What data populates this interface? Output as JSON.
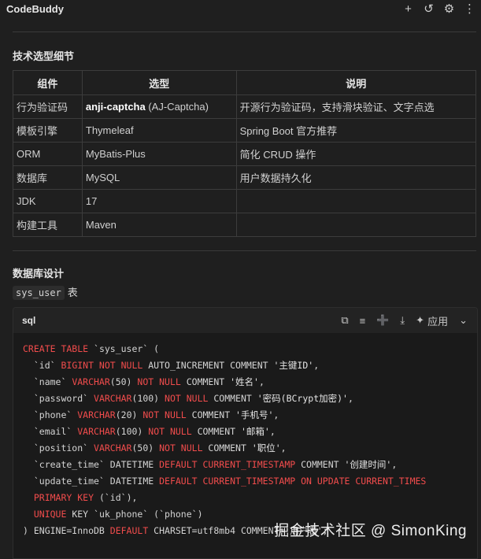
{
  "app": {
    "title": "CodeBuddy",
    "icons": [
      "plus-icon",
      "history-icon",
      "gear-icon",
      "more-icon"
    ]
  },
  "section1": {
    "heading": "技术选型细节",
    "table": {
      "headers": [
        "组件",
        "选型",
        "说明"
      ],
      "rows": [
        {
          "component": "行为验证码",
          "choice_bold": "anji-captcha",
          "choice_rest": " (AJ-Captcha)",
          "desc": "开源行为验证码，支持滑块验证、文字点选"
        },
        {
          "component": "模板引擎",
          "choice_bold": "",
          "choice_rest": "Thymeleaf",
          "desc": "Spring Boot 官方推荐"
        },
        {
          "component": "ORM",
          "choice_bold": "",
          "choice_rest": "MyBatis-Plus",
          "desc": "简化 CRUD 操作"
        },
        {
          "component": "数据库",
          "choice_bold": "",
          "choice_rest": "MySQL",
          "desc": "用户数据持久化"
        },
        {
          "component": "JDK",
          "choice_bold": "",
          "choice_rest": "17",
          "desc": ""
        },
        {
          "component": "构建工具",
          "choice_bold": "",
          "choice_rest": "Maven",
          "desc": ""
        }
      ]
    }
  },
  "section2": {
    "heading": "数据库设计",
    "table_name": "sys_user",
    "table_suffix": "表"
  },
  "codeblock": {
    "language": "sql",
    "apply_label": "应用",
    "lines": [
      [
        [
          "k",
          "CREATE TABLE"
        ],
        [
          "p",
          " `sys_user` ("
        ]
      ],
      [
        [
          "p",
          "  `id` "
        ],
        [
          "k",
          "BIGINT NOT NULL"
        ],
        [
          "p",
          " AUTO_INCREMENT COMMENT "
        ],
        [
          "s",
          "'主键ID'"
        ],
        [
          "p",
          ","
        ]
      ],
      [
        [
          "p",
          "  `name` "
        ],
        [
          "k",
          "VARCHAR"
        ],
        [
          "p",
          "(50) "
        ],
        [
          "k",
          "NOT NULL"
        ],
        [
          "p",
          " COMMENT "
        ],
        [
          "s",
          "'姓名'"
        ],
        [
          "p",
          ","
        ]
      ],
      [
        [
          "p",
          "  `password` "
        ],
        [
          "k",
          "VARCHAR"
        ],
        [
          "p",
          "(100) "
        ],
        [
          "k",
          "NOT NULL"
        ],
        [
          "p",
          " COMMENT "
        ],
        [
          "s",
          "'密码(BCrypt加密)'"
        ],
        [
          "p",
          ","
        ]
      ],
      [
        [
          "p",
          "  `phone` "
        ],
        [
          "k",
          "VARCHAR"
        ],
        [
          "p",
          "(20) "
        ],
        [
          "k",
          "NOT NULL"
        ],
        [
          "p",
          " COMMENT "
        ],
        [
          "s",
          "'手机号'"
        ],
        [
          "p",
          ","
        ]
      ],
      [
        [
          "p",
          "  `email` "
        ],
        [
          "k",
          "VARCHAR"
        ],
        [
          "p",
          "(100) "
        ],
        [
          "k",
          "NOT NULL"
        ],
        [
          "p",
          " COMMENT "
        ],
        [
          "s",
          "'邮箱'"
        ],
        [
          "p",
          ","
        ]
      ],
      [
        [
          "p",
          "  `position` "
        ],
        [
          "k",
          "VARCHAR"
        ],
        [
          "p",
          "(50) "
        ],
        [
          "k",
          "NOT NULL"
        ],
        [
          "p",
          " COMMENT "
        ],
        [
          "s",
          "'职位'"
        ],
        [
          "p",
          ","
        ]
      ],
      [
        [
          "p",
          "  `create_time` DATETIME "
        ],
        [
          "k",
          "DEFAULT CURRENT_TIMESTAMP"
        ],
        [
          "p",
          " COMMENT "
        ],
        [
          "s",
          "'创建时间'"
        ],
        [
          "p",
          ","
        ]
      ],
      [
        [
          "p",
          "  `update_time` DATETIME "
        ],
        [
          "k",
          "DEFAULT CURRENT_TIMESTAMP ON UPDATE CURRENT_TIMES"
        ]
      ],
      [
        [
          "p",
          "  "
        ],
        [
          "k",
          "PRIMARY KEY"
        ],
        [
          "p",
          " (`id`),"
        ]
      ],
      [
        [
          "p",
          "  "
        ],
        [
          "k",
          "UNIQUE"
        ],
        [
          "p",
          " KEY `uk_phone` (`phone`)"
        ]
      ],
      [
        [
          "p",
          ") ENGINE=InnoDB "
        ],
        [
          "k",
          "DEFAULT"
        ],
        [
          "p",
          " CHARSET=utf8mb4 COMMENT='用户表';"
        ]
      ]
    ]
  },
  "watermark": "掘金技术社区 @ SimonKing"
}
